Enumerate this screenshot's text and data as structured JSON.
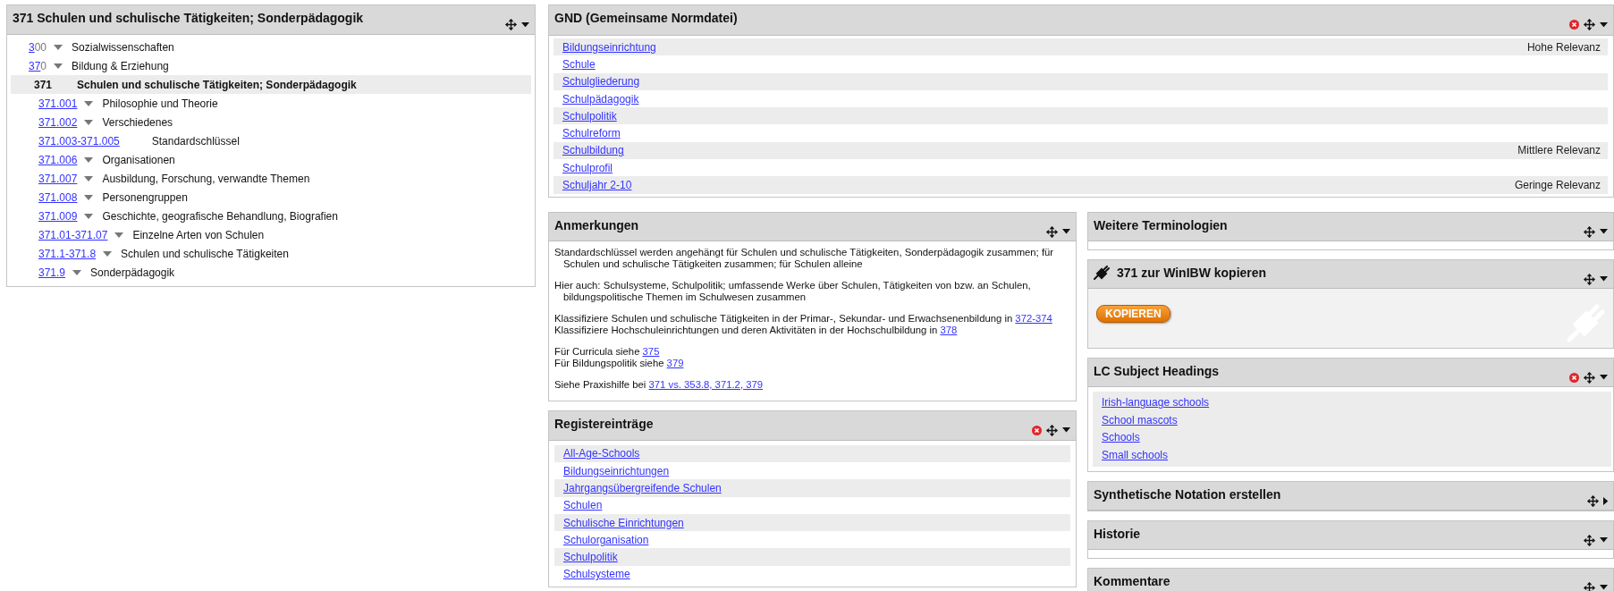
{
  "classification_panel": {
    "title": "371 Schulen und schulische Tätigkeiten; Sonderpädagogik",
    "expanded": true,
    "tree": [
      {
        "notation": [
          {
            "text": "3",
            "link": true
          },
          {
            "text": "00",
            "link": false
          }
        ],
        "label": "Sozialwissenschaften",
        "expandable": true,
        "selected": false
      },
      {
        "notation": [
          {
            "text": "37",
            "link": true
          },
          {
            "text": "0",
            "link": false
          }
        ],
        "label": "Bildung & Erziehung",
        "expandable": true,
        "selected": false
      },
      {
        "notation": [
          {
            "text": "371",
            "link": false
          }
        ],
        "label": "Schulen und schulische Tätigkeiten; Sonderpädagogik",
        "expandable": false,
        "selected": true,
        "children": [
          {
            "notation": [
              {
                "text": "371.001",
                "link": true
              }
            ],
            "label": "Philosophie und Theorie",
            "expandable": true,
            "selected": false
          },
          {
            "notation": [
              {
                "text": "371.002",
                "link": true
              }
            ],
            "label": "Verschiedenes",
            "expandable": true,
            "selected": false
          },
          {
            "notation": [
              {
                "text": "371.003-371.005",
                "link": true
              }
            ],
            "label": "Standardschlüssel",
            "expandable": false,
            "selected": false
          },
          {
            "notation": [
              {
                "text": "371.006",
                "link": true
              }
            ],
            "label": "Organisationen",
            "expandable": true,
            "selected": false
          },
          {
            "notation": [
              {
                "text": "371.007",
                "link": true
              }
            ],
            "label": "Ausbildung, Forschung, verwandte Themen",
            "expandable": true,
            "selected": false
          },
          {
            "notation": [
              {
                "text": "371.008",
                "link": true
              }
            ],
            "label": "Personengruppen",
            "expandable": true,
            "selected": false
          },
          {
            "notation": [
              {
                "text": "371.009",
                "link": true
              }
            ],
            "label": "Geschichte, geografische Behandlung, Biografien",
            "expandable": true,
            "selected": false
          },
          {
            "notation": [
              {
                "text": "371.01-371.07",
                "link": true
              }
            ],
            "label": "Einzelne Arten von Schulen",
            "expandable": true,
            "selected": false
          },
          {
            "notation": [
              {
                "text": "371.1-371.8",
                "link": true
              }
            ],
            "label": "Schulen und schulische Tätigkeiten",
            "expandable": true,
            "selected": false
          },
          {
            "notation": [
              {
                "text": "371.9",
                "link": true
              }
            ],
            "label": "Sonderpädagogik",
            "expandable": true,
            "selected": false
          }
        ]
      }
    ]
  },
  "gnd_panel": {
    "title": "GND (Gemeinsame Normdatei)",
    "closable": true,
    "expanded": true,
    "rows": [
      {
        "term": "Bildungseinrichtung",
        "relevance": "Hohe Relevanz"
      },
      {
        "term": "Schule"
      },
      {
        "term": "Schulgliederung"
      },
      {
        "term": "Schulpädagogik"
      },
      {
        "term": "Schulpolitik"
      },
      {
        "term": "Schulreform"
      },
      {
        "term": "Schulbildung",
        "relevance": "Mittlere Relevanz"
      },
      {
        "term": "Schulprofil"
      },
      {
        "term": "Schuljahr 2-10",
        "relevance": "Geringe Relevanz"
      }
    ]
  },
  "notes_panel": {
    "title": "Anmerkungen",
    "closable": false,
    "expanded": true,
    "paragraphs": [
      {
        "lines": [
          {
            "text": "Standardschlüssel werden angehängt für Schulen und schulische Tätigkeiten, Sonderpädagogik zusammen; für Schulen und schulische Tätigkeiten zusammen; für Schulen alleine"
          }
        ]
      },
      {
        "lines": [
          {
            "text": "Hier auch: Schulsysteme, Schulpolitik; umfassende Werke über Schulen, Tätigkeiten von bzw. an Schulen, bildungspolitische Themen im Schulwesen zusammen"
          }
        ]
      },
      {
        "lines": [
          {
            "text": "Klassifiziere Schulen und schulische Tätigkeiten in der Primar-, Sekundar- und Erwachsenenbildung in ",
            "link": "372-374"
          },
          {
            "text": "Klassifiziere Hochschuleinrichtungen und deren Aktivitäten in der Hochschulbildung in ",
            "link": "378"
          }
        ]
      },
      {
        "lines": [
          {
            "text": "Für Curricula siehe ",
            "link": "375"
          },
          {
            "text": "Für Bildungspolitik siehe ",
            "link": "379"
          }
        ]
      },
      {
        "lines": [
          {
            "text": "Siehe Praxishilfe bei ",
            "link": "371 vs. 353.8, 371.2, 379"
          }
        ]
      }
    ]
  },
  "register_panel": {
    "title": "Registereinträge",
    "closable": true,
    "expanded": true,
    "entries": [
      "All-Age-Schools",
      "Bildungseinrichtungen",
      "Jahrgangsübergreifende Schulen",
      "Schulen",
      "Schulische Einrichtungen",
      "Schulorganisation",
      "Schulpolitik",
      "Schulsysteme"
    ]
  },
  "side_panels": [
    {
      "kind": "empty",
      "title": "Weitere Terminologien",
      "closable": false,
      "expanded": true
    },
    {
      "kind": "copy",
      "title": "371 zur WinIBW kopieren",
      "closable": false,
      "expanded": true,
      "button": "KOPIEREN"
    },
    {
      "kind": "links",
      "title": "LC Subject Headings",
      "closable": true,
      "expanded": true,
      "links": [
        "Irish-language schools",
        "School mascots",
        "Schools",
        "Small schools"
      ]
    },
    {
      "kind": "collapsed",
      "title": "Synthetische Notation erstellen",
      "closable": false,
      "expanded": false
    },
    {
      "kind": "empty",
      "title": "Historie",
      "closable": false,
      "expanded": true
    },
    {
      "kind": "empty",
      "title": "Kommentare",
      "closable": false,
      "expanded": true
    }
  ]
}
